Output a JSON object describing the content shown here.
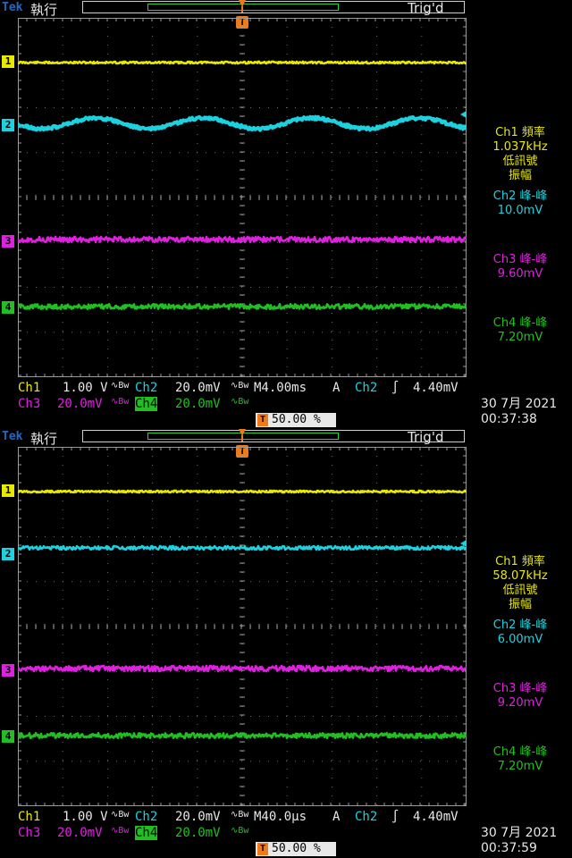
{
  "colors": {
    "ch1": "#e8e800",
    "ch2": "#1ad2e0",
    "ch3": "#e020e0",
    "ch4": "#20c020",
    "trigger": "#f07a1a",
    "brand": "#1f6cc4"
  },
  "screens": [
    {
      "brand": "Tek",
      "run_status": "執行",
      "trig_status": "Trig'd",
      "trigger_marker": "T",
      "channel_markers": [
        "1",
        "2",
        "3",
        "4"
      ],
      "measurements": [
        {
          "label": "Ch1 頻率",
          "value": "1.037kHz",
          "note1": "低訊號",
          "note2": "振幅"
        },
        {
          "label": "Ch2 峰-峰",
          "value": "10.0mV"
        },
        {
          "label": "Ch3 峰-峰",
          "value": "9.60mV"
        },
        {
          "label": "Ch4 峰-峰",
          "value": "7.20mV"
        }
      ],
      "ch1_label": "Ch1",
      "ch1_scale": "1.00 V",
      "ch2_label": "Ch2",
      "ch2_scale": "20.0mV",
      "ch3_label": "Ch3",
      "ch3_scale": "20.0mV",
      "ch4_label": "Ch4",
      "ch4_scale": "20.0mV",
      "bw_symbol": "∿Bw",
      "timebase": "M4.00ms",
      "trig_mode": "A",
      "trig_source": "Ch2",
      "trig_slope": "∫",
      "trig_level": "4.40mV",
      "trig_position": "50.00 %",
      "date": "30 7月  2021",
      "time": "00:37:38",
      "ch2_waveform": "sine"
    },
    {
      "brand": "Tek",
      "run_status": "執行",
      "trig_status": "Trig'd",
      "trigger_marker": "T",
      "channel_markers": [
        "1",
        "2",
        "3",
        "4"
      ],
      "measurements": [
        {
          "label": "Ch1 頻率",
          "value": "58.07kHz",
          "note1": "低訊號",
          "note2": "振幅"
        },
        {
          "label": "Ch2 峰-峰",
          "value": "6.00mV"
        },
        {
          "label": "Ch3 峰-峰",
          "value": "9.20mV"
        },
        {
          "label": "Ch4 峰-峰",
          "value": "7.20mV"
        }
      ],
      "ch1_label": "Ch1",
      "ch1_scale": "1.00 V",
      "ch2_label": "Ch2",
      "ch2_scale": "20.0mV",
      "ch3_label": "Ch3",
      "ch3_scale": "20.0mV",
      "ch4_label": "Ch4",
      "ch4_scale": "20.0mV",
      "bw_symbol": "∿Bw",
      "timebase": "M40.0µs",
      "trig_mode": "A",
      "trig_source": "Ch2",
      "trig_slope": "∫",
      "trig_level": "4.40mV",
      "trig_position": "50.00 %",
      "date": "30 7月  2021",
      "time": "00:37:59",
      "ch2_waveform": "flat"
    }
  ]
}
